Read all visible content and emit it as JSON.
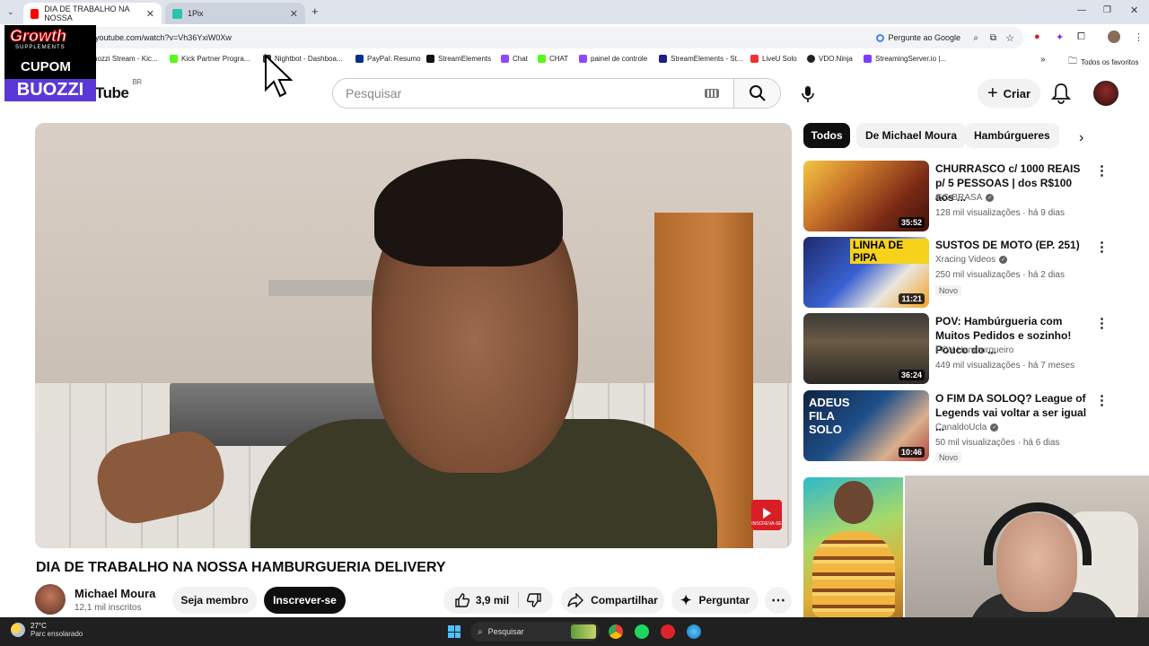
{
  "browser": {
    "tabs": [
      {
        "title": "DIA DE TRABALHO NA NOSSA",
        "active": true
      },
      {
        "title": "1Pix",
        "active": false
      }
    ],
    "new_tab": "+",
    "url": "youtube.com/watch?v=Vh36YxiW0Xw",
    "ask_google": "Pergunte ao Google",
    "bookmarks": [
      "uozzi Stream - Kic...",
      "Kick Partner Progra...",
      "Nightbot - Dashboa...",
      "PayPal: Resumo",
      "StreamElements",
      "Chat",
      "CHAT",
      "painel de controle",
      "StreamElements - St...",
      "LiveU Solo",
      "VDO.Ninja",
      "StreamingServer.io |..."
    ],
    "all_favorites": "Todos os favoritos"
  },
  "overlay_logo": {
    "line1": "Growth",
    "line2": "SUPPLEMENTS",
    "line3": "CUPOM",
    "line4": "BUOZZI"
  },
  "youtube": {
    "logo": "Tube",
    "region": "BR",
    "search_placeholder": "Pesquisar",
    "create_label": "Criar"
  },
  "video": {
    "title": "DIA DE TRABALHO NA NOSSA HAMBURGUERIA DELIVERY",
    "channel": "Michael Moura",
    "subscribers": "12,1 mil inscritos",
    "member_label": "Seja membro",
    "subscribe_label": "Inscrever-se",
    "likes": "3,9 mil",
    "share_label": "Compartilhar",
    "ask_label": "Perguntar",
    "watermark": "INSCREVA-SE"
  },
  "chips": [
    "Todos",
    "De Michael Moura",
    "Hambúrgueres"
  ],
  "recommendations": [
    {
      "title": "CHURRASCO c/ 1000 REAIS p/ 5 PESSOAS | dos R$100 aos ...",
      "channel": "GG BRASA",
      "verified": true,
      "meta": "128 mil visualizações · há 9 dias",
      "duration": "35:52",
      "new": ""
    },
    {
      "title": "SUSTOS DE MOTO (EP. 251)",
      "channel": "Xracing Videos",
      "verified": true,
      "meta": "250 mil visualizações · há 2 dias",
      "duration": "11:21",
      "new": "Novo",
      "thumb_text": "LINHA DE PIPA"
    },
    {
      "title": "POV: Hambúrgueria com Muitos Pedidos e sozinho! Pouco do ...",
      "channel": "POV Hamburgueiro",
      "verified": false,
      "meta": "449 mil visualizações · há 7 meses",
      "duration": "36:24",
      "new": ""
    },
    {
      "title": "O FIM DA SOLOQ? League of Legends vai voltar a ser igual ...",
      "channel": "CanaldoUcla",
      "verified": true,
      "meta": "50 mil visualizações · há 6 dias",
      "duration": "10:46",
      "new": "Novo",
      "thumb_text": "ADEUS FILA SOLO"
    }
  ],
  "taskbar": {
    "temperature": "27°C",
    "weather": "Parc ensolarado",
    "search_placeholder": "Pesquisar"
  }
}
